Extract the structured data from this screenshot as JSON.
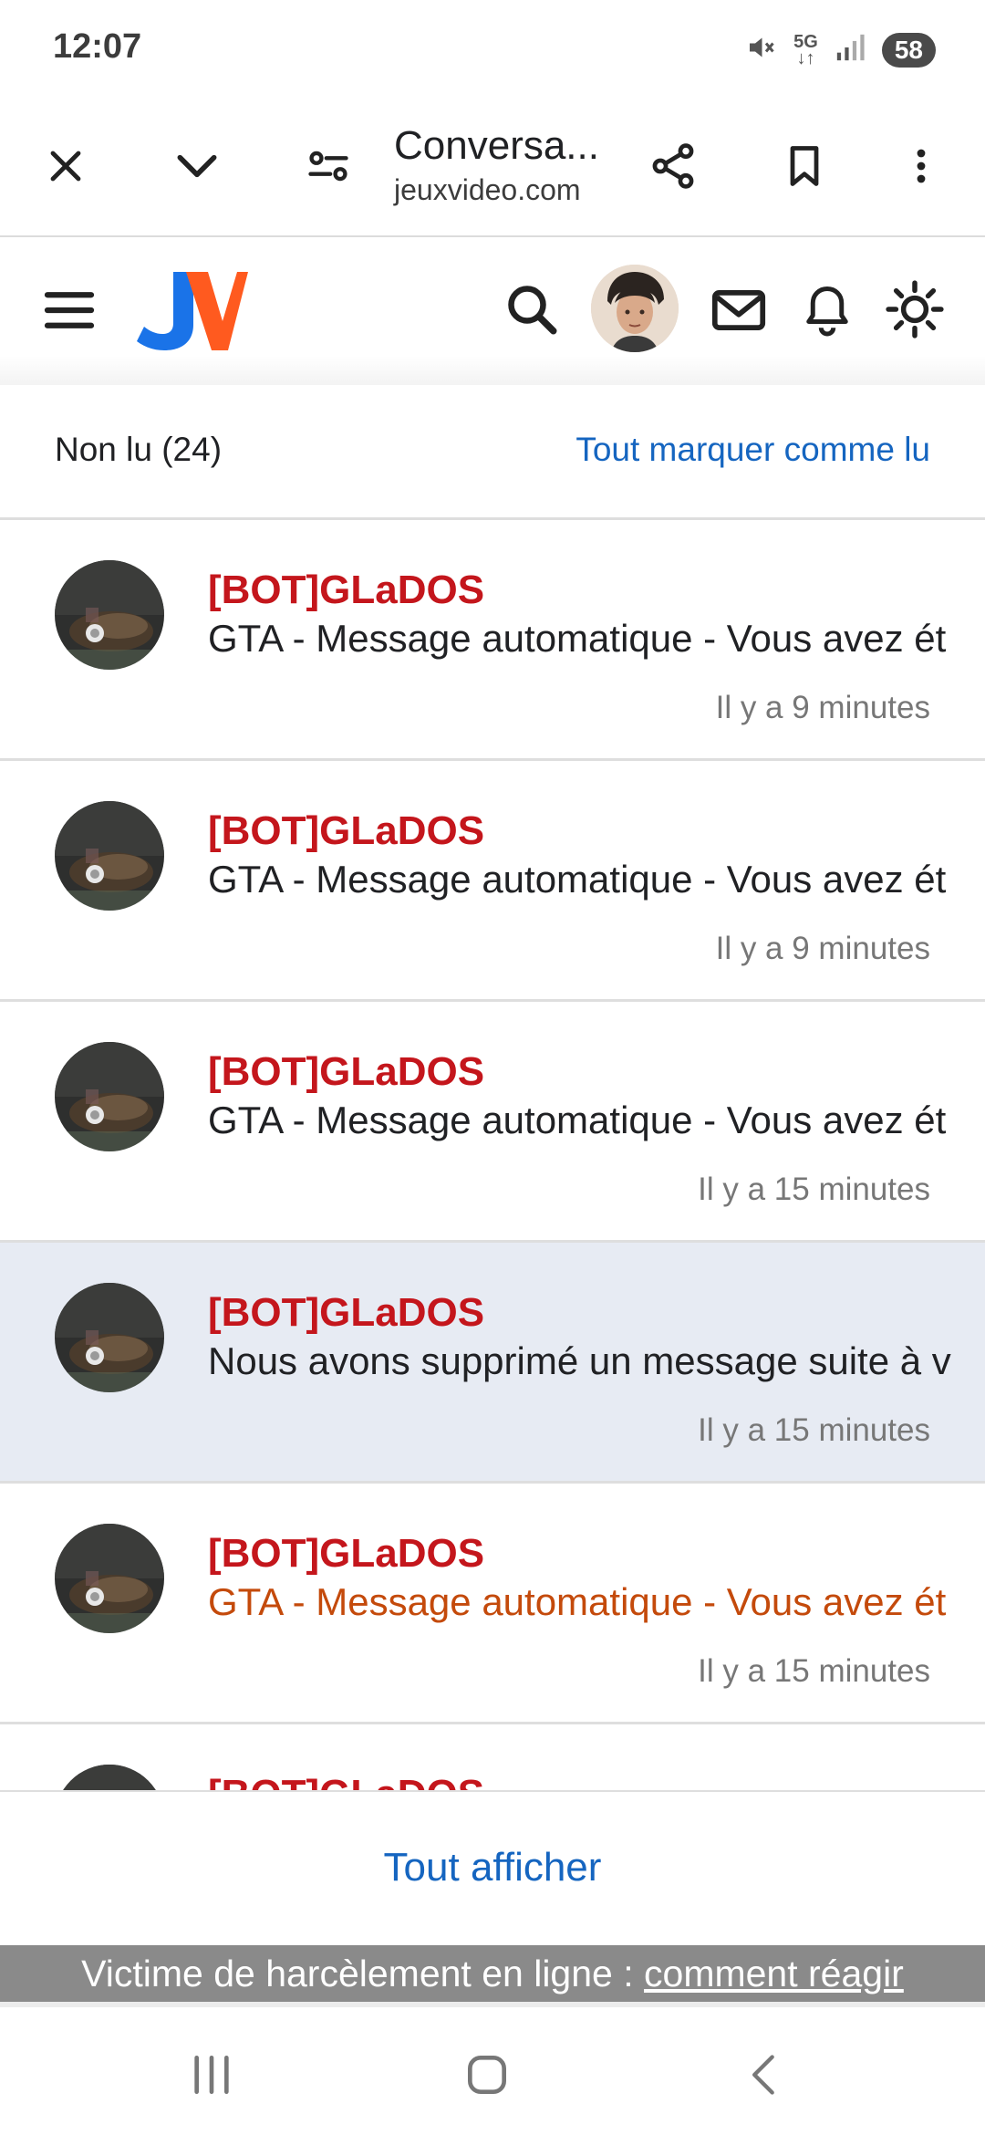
{
  "status_bar": {
    "time": "12:07",
    "network": "5G",
    "battery": "58",
    "icons": [
      "mute-icon",
      "5g-icon",
      "signal-icon",
      "battery-icon"
    ]
  },
  "browser": {
    "title": "Conversa...",
    "url": "jeuxvideo.com",
    "icons": [
      "close-icon",
      "chevron-down-icon",
      "site-settings-icon",
      "share-icon",
      "bookmark-icon",
      "more-vert-icon"
    ]
  },
  "site_header": {
    "logo_text": "JV",
    "icons": [
      "menu-icon",
      "search-icon",
      "mail-icon",
      "bell-icon",
      "theme-sun-icon"
    ]
  },
  "notifications": {
    "unread_label": "Non lu (24)",
    "mark_all_label": "Tout marquer comme lu",
    "items": [
      {
        "author": "[BOT]GLaDOS",
        "text": "GTA - Message automatique - Vous avez ét",
        "time": "Il y a 9 minutes",
        "highlight": false,
        "orange": false
      },
      {
        "author": "[BOT]GLaDOS",
        "text": "GTA - Message automatique - Vous avez ét",
        "time": "Il y a 9 minutes",
        "highlight": false,
        "orange": false
      },
      {
        "author": "[BOT]GLaDOS",
        "text": "GTA - Message automatique - Vous avez ét",
        "time": "Il y a 15 minutes",
        "highlight": false,
        "orange": false
      },
      {
        "author": "[BOT]GLaDOS",
        "text": "Nous avons supprimé un message suite à v",
        "time": "Il y a 15 minutes",
        "highlight": true,
        "orange": false
      },
      {
        "author": "[BOT]GLaDOS",
        "text": "GTA - Message automatique - Vous avez ét",
        "time": "Il y a 15 minutes",
        "highlight": false,
        "orange": true
      },
      {
        "author": "[BOT]GLaDOS",
        "text": "",
        "time": "",
        "highlight": false,
        "orange": false
      }
    ],
    "show_all_label": "Tout afficher"
  },
  "harassment_bar": {
    "text": "Victime de harcèlement en ligne : ",
    "link": "comment réagir"
  },
  "colors": {
    "author": "#c4161c",
    "link": "#1565c0",
    "orange_text": "#c44a0b",
    "highlight_row": "#e7ebf3"
  }
}
